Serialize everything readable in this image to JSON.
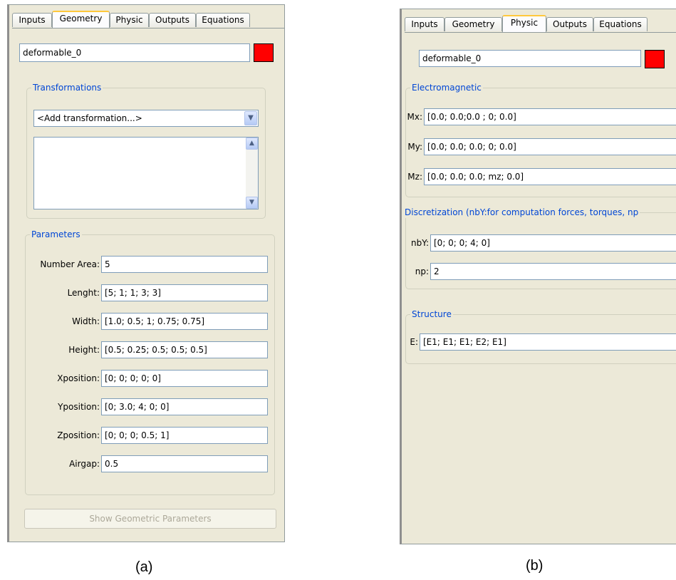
{
  "panel_a": {
    "tabs": [
      {
        "label": "Inputs",
        "active": false
      },
      {
        "label": "Geometry",
        "active": true
      },
      {
        "label": "Physic",
        "active": false
      },
      {
        "label": "Outputs",
        "active": false
      },
      {
        "label": "Equations",
        "active": false
      }
    ],
    "name_value": "deformable_0",
    "color": "#ff0000",
    "transformations": {
      "title": "Transformations",
      "select_value": "<Add transformation...>"
    },
    "parameters": {
      "title": "Parameters",
      "fields": [
        {
          "label": "Number Area:",
          "value": "5"
        },
        {
          "label": "Lenght:",
          "value": "[5; 1; 1; 3; 3]"
        },
        {
          "label": "Width:",
          "value": "[1.0; 0.5; 1; 0.75; 0.75]"
        },
        {
          "label": "Height:",
          "value": "[0.5; 0.25; 0.5; 0.5; 0.5]"
        },
        {
          "label": "Xposition:",
          "value": "[0; 0; 0; 0; 0]"
        },
        {
          "label": "Yposition:",
          "value": "[0; 3.0; 4; 0; 0]"
        },
        {
          "label": "Zposition:",
          "value": "[0; 0; 0; 0.5; 1]"
        },
        {
          "label": "Airgap:",
          "value": "0.5"
        }
      ]
    },
    "show_button": "Show Geometric Parameters",
    "caption": "(a)"
  },
  "panel_b": {
    "tabs": [
      {
        "label": "Inputs",
        "active": false
      },
      {
        "label": "Geometry",
        "active": false
      },
      {
        "label": "Physic",
        "active": true
      },
      {
        "label": "Outputs",
        "active": false
      },
      {
        "label": "Equations",
        "active": false
      }
    ],
    "name_value": "deformable_0",
    "color": "#ff0000",
    "electromagnetic": {
      "title": "Electromagnetic",
      "fields": [
        {
          "label": "Mx:",
          "value": "[0.0; 0.0;0.0 ; 0; 0.0]"
        },
        {
          "label": "My:",
          "value": "[0.0; 0.0; 0.0; 0; 0.0]"
        },
        {
          "label": "Mz:",
          "value": "[0.0; 0.0; 0.0; mz; 0.0]"
        }
      ]
    },
    "discretization": {
      "title": "Discretization (nbY:for computation forces, torques, np",
      "fields": [
        {
          "label": "nbY:",
          "value": "[0; 0;  0; 4; 0]"
        },
        {
          "label": "np:",
          "value": "2"
        }
      ]
    },
    "structure": {
      "title": "Structure",
      "fields": [
        {
          "label": "E:",
          "value": "[E1; E1; E1; E2; E1]"
        }
      ]
    },
    "caption": "(b)"
  }
}
